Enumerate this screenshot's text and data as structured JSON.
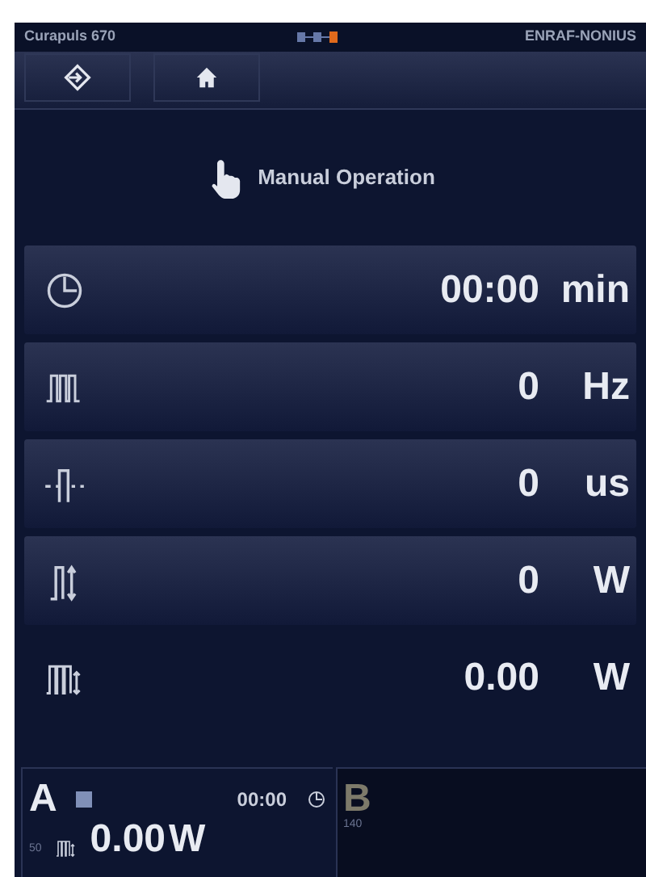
{
  "status_bar": {
    "device": "Curapuls 670",
    "brand": "ENRAF-NONIUS"
  },
  "toolbar": {
    "buttons": [
      {
        "kind": "exit"
      },
      {
        "kind": "home"
      }
    ]
  },
  "title": "Manual Operation",
  "parameters": [
    {
      "kind": "time",
      "value": "00:00",
      "unit": "min",
      "boxed": true
    },
    {
      "kind": "frequency",
      "value": "0",
      "unit": "Hz",
      "boxed": true
    },
    {
      "kind": "pulse",
      "value": "0",
      "unit": "us",
      "boxed": true
    },
    {
      "kind": "peak",
      "value": "0",
      "unit": "W",
      "boxed": true
    },
    {
      "kind": "average",
      "value": "0.00",
      "unit": "W",
      "boxed": false
    }
  ],
  "channels": [
    {
      "label": "A",
      "active": true,
      "time": "00:00",
      "number": "50",
      "power": "0.00",
      "unit": "W"
    },
    {
      "label": "B",
      "active": false,
      "number": "140"
    }
  ]
}
